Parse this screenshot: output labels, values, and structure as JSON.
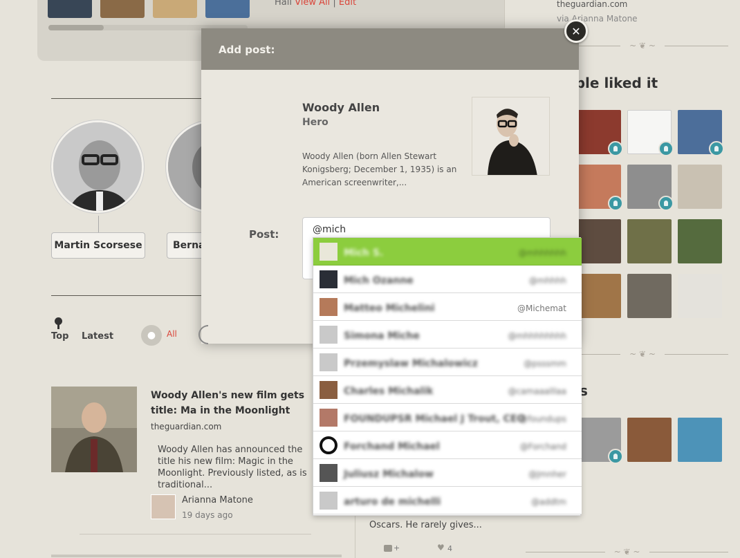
{
  "hall": {
    "prefix": "Hall ",
    "view_all": "View All",
    "separator": " | ",
    "edit": "Edit"
  },
  "people": [
    {
      "name": "Martin Scorsese"
    },
    {
      "name": "Bernar"
    }
  ],
  "filters": {
    "top": "Top",
    "latest": "Latest",
    "all": "All"
  },
  "article": {
    "title": "Woody Allen's new film gets title: Ma in the Moonlight",
    "source": "theguardian.com",
    "body": "Woody Allen has announced the title his new film: Magic in the Moonlight. Previously listed, as is traditional...",
    "author": "Arianna Matone",
    "time": "19 days ago"
  },
  "right": {
    "source": "theguardian.com",
    "via": "via Arianna Matone",
    "liked_heading": "ople liked it",
    "second_heading": "s",
    "snippet": "Oscars. He rarely gives...",
    "comment_plus": "+",
    "likes": "4"
  },
  "modal": {
    "title": "Add post:",
    "person_name": "Woody Allen",
    "person_role": "Hero",
    "person_desc": "Woody Allen (born Allen Stewart Konigsberg; December 1, 1935) is an American screenwriter,...",
    "post_label": "Post:",
    "post_value": "@mich",
    "close": "✕"
  },
  "suggestions": [
    {
      "name": "Mich S.",
      "handle": "@mhhhhhh",
      "active": true
    },
    {
      "name": "Mich Ozanne",
      "handle": "@mhhhh"
    },
    {
      "name": "Matteo Michelini",
      "handle": "@Michemat"
    },
    {
      "name": "Simona Miche",
      "handle": "@mhhhhhhhh"
    },
    {
      "name": "Przemyslaw Michalowicz",
      "handle": "@psssmm"
    },
    {
      "name": "Charles Michalik",
      "handle": "@camaaalllaa"
    },
    {
      "name": "FOUNDUPSR Michael J Trout, CEO",
      "handle": "@foundups"
    },
    {
      "name": "Forchand Michael",
      "handle": "@Forchand"
    },
    {
      "name": "Juliusz Michalow",
      "handle": "@Jmnher"
    },
    {
      "name": "arturo de michelli",
      "handle": "@addtm"
    }
  ],
  "colors": {
    "accent": "#d9453a",
    "highlight": "#8ccd3e",
    "badge": "#3b98a3",
    "header": "#8d8a81"
  }
}
